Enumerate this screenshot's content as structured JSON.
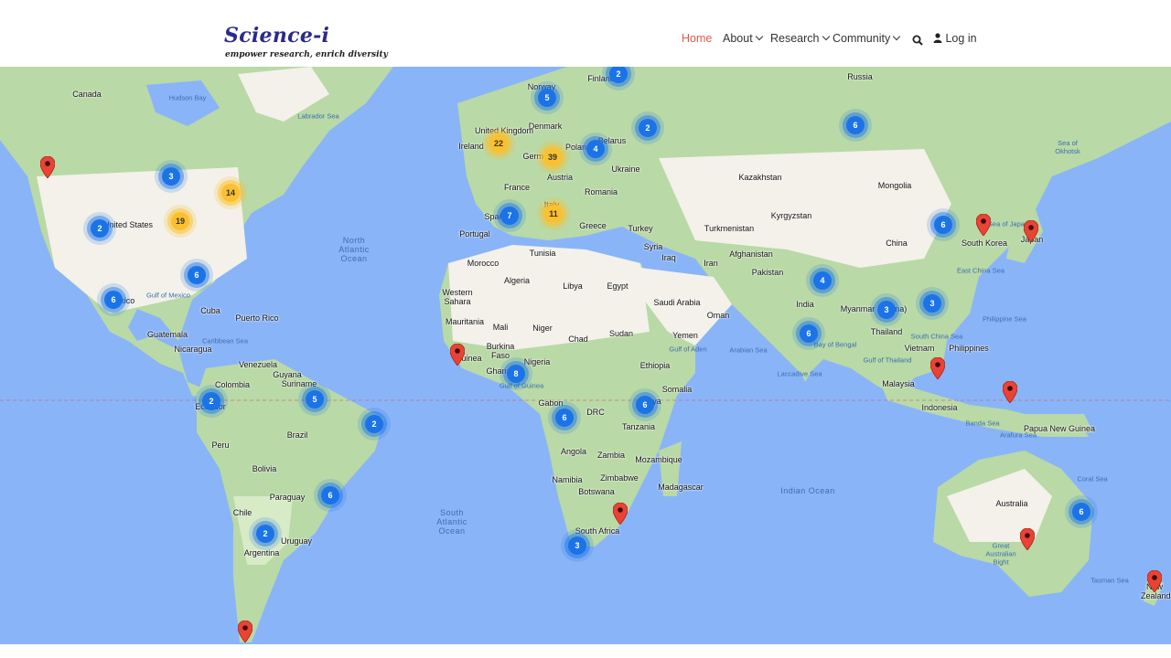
{
  "header": {
    "logo": "Science-i",
    "tagline": "empower research, enrich diversity",
    "nav": {
      "home": "Home",
      "about": "About",
      "research": "Research",
      "community": "Community",
      "login": "Log in"
    },
    "accent_color": "#e05a4f"
  },
  "map": {
    "labels": {
      "canada": "Canada",
      "hudson_bay": "Hudson Bay",
      "labrador_sea": "Labrador Sea",
      "united_states": "United States",
      "mexico": "Mexico",
      "gulf_mexico": "Gulf of\nMexico",
      "cuba": "Cuba",
      "puerto_rico": "Puerto Rico",
      "guatemala": "Guatemala",
      "nicaragua": "Nicaragua",
      "caribbean_sea": "Caribbean Sea",
      "venezuela": "Venezuela",
      "colombia": "Colombia",
      "guyana": "Guyana",
      "suriname": "Suriname",
      "ecuador": "Ecuador",
      "peru": "Peru",
      "brazil": "Brazil",
      "bolivia": "Bolivia",
      "paraguay": "Paraguay",
      "chile": "Chile",
      "uruguay": "Uruguay",
      "argentina": "Argentina",
      "north_atlantic": "North Atlantic Ocean",
      "south_atlantic": "South Atlantic Ocean",
      "norway": "Norway",
      "finland": "Finland",
      "denmark": "Denmark",
      "united_kingdom": "United Kingdom",
      "ireland": "Ireland",
      "germany": "Germany",
      "poland": "Poland",
      "belarus": "Belarus",
      "ukraine": "Ukraine",
      "austria": "Austria",
      "france": "France",
      "romania": "Romania",
      "spain": "Spain",
      "portugal": "Portugal",
      "italy": "Italy",
      "greece": "Greece",
      "turkey": "Turkey",
      "russia": "Russia",
      "kazakhstan": "Kazakhstan",
      "mongolia": "Mongolia",
      "kyrgyzstan": "Kyrgyzstan",
      "turkmenistan": "Turkmenistan",
      "syria": "Syria",
      "iraq": "Iraq",
      "iran": "Iran",
      "afghanistan": "Afghanistan",
      "pakistan": "Pakistan",
      "china": "China",
      "south_korea": "South Korea",
      "japan": "Japan",
      "sea_okhotsk": "Sea of\nOkhotsk",
      "sea_japan": "Sea of Japan",
      "east_china_sea": "East China Sea",
      "india": "India",
      "myanmar": "Myanmar (Burma)",
      "thailand": "Thailand",
      "vietnam": "Vietnam",
      "philippines": "Philippines",
      "philippine_sea": "Philippine Sea",
      "south_china_sea": "South China Sea",
      "gulf_thailand": "Gulf of Thailand",
      "malaysia": "Malaysia",
      "indonesia": "Indonesia",
      "papua": "Papua New Guinea",
      "banda_sea": "Banda Sea",
      "arafura_sea": "Arafura Sea",
      "coral_sea": "Coral Sea",
      "arabian_sea": "Arabian Sea",
      "bay_bengal": "Bay of Bengal",
      "laccadive": "Laccadive Sea",
      "indian_ocean": "Indian Ocean",
      "morocco": "Morocco",
      "algeria": "Algeria",
      "tunisia": "Tunisia",
      "libya": "Libya",
      "egypt": "Egypt",
      "western_sahara": "Western Sahara",
      "mauritania": "Mauritania",
      "mali": "Mali",
      "niger": "Niger",
      "chad": "Chad",
      "sudan": "Sudan",
      "saudi": "Saudi Arabia",
      "oman": "Oman",
      "yemen": "Yemen",
      "gulf_aden": "Gulf of Aden",
      "burkina": "Burkina Faso",
      "nigeria": "Nigeria",
      "guinea": "Guinea",
      "ghana": "Ghana",
      "gulf_guinea": "Gulf of Guinea",
      "ethiopia": "Ethiopia",
      "somalia": "Somalia",
      "gabon": "Gabon",
      "drc": "DRC",
      "kenya": "Kenya",
      "tanzania": "Tanzania",
      "angola": "Angola",
      "zambia": "Zambia",
      "mozambique": "Mozambique",
      "namibia": "Namibia",
      "zimbabwe": "Zimbabwe",
      "botswana": "Botswana",
      "madagascar": "Madagascar",
      "south_africa": "South Africa",
      "australia": "Australia",
      "great_bight": "Great\nAustralian\nBight",
      "tasman": "Tasman Sea",
      "new_zealand": "New\nZealand"
    },
    "clusters": [
      "3",
      "14",
      "19",
      "2",
      "6",
      "6",
      "2",
      "5",
      "2",
      "2",
      "6",
      "2",
      "22",
      "39",
      "4",
      "2",
      "5",
      "6",
      "7",
      "11",
      "8",
      "6",
      "6",
      "3",
      "4",
      "6",
      "3",
      "3",
      "6",
      "6",
      "6"
    ]
  }
}
